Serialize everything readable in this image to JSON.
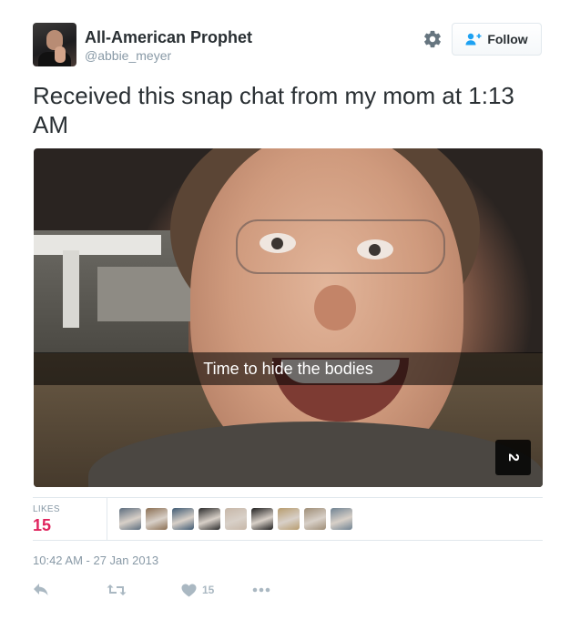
{
  "header": {
    "display_name": "All-American Prophet",
    "handle": "@abbie_meyer",
    "follow_label": "Follow"
  },
  "tweet": {
    "text": "Received this snap chat from my mom at 1:13 AM",
    "photo": {
      "caption": "Time to hide the bodies",
      "badge": "2"
    }
  },
  "stats": {
    "likes_label": "LIKES",
    "likes_count": "15",
    "likers": [
      {
        "icon": "user-avatar",
        "color": "#5c6d7e"
      },
      {
        "icon": "user-avatar",
        "color": "#8a6e52"
      },
      {
        "icon": "user-avatar",
        "color": "#3f5a73"
      },
      {
        "icon": "user-avatar",
        "color": "#2b2b2b"
      },
      {
        "icon": "user-avatar",
        "color": "#c7b7a8"
      },
      {
        "icon": "user-avatar",
        "color": "#1f1f1f"
      },
      {
        "icon": "user-avatar",
        "color": "#b79c6e"
      },
      {
        "icon": "user-avatar",
        "color": "#9e8d76"
      },
      {
        "icon": "user-avatar",
        "color": "#6f8292"
      }
    ]
  },
  "timestamp": "10:42 AM - 27 Jan 2013",
  "actions": {
    "reply_icon": "reply-icon",
    "retweet_icon": "retweet-icon",
    "like_icon": "heart-icon",
    "like_count": "15",
    "more_icon": "more-icon"
  },
  "colors": {
    "like_pink": "#e0245e",
    "follow_blue": "#1da1f2",
    "muted_text": "#8899a6",
    "action_gray": "#aab8c2"
  }
}
